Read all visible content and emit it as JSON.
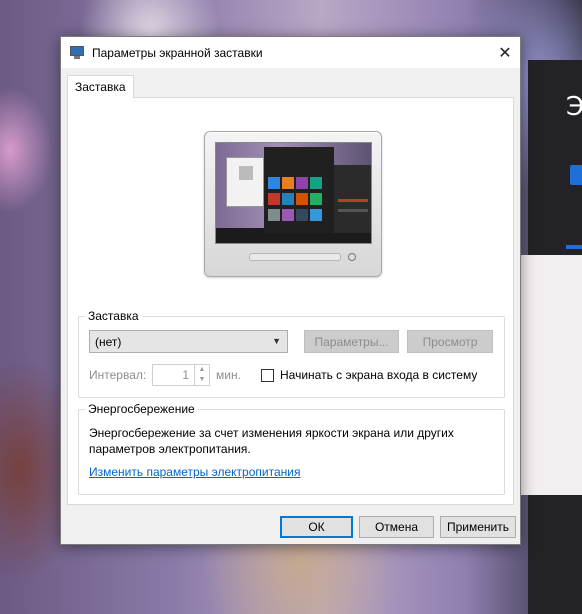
{
  "window": {
    "title": "Параметры экранной заставки",
    "close_glyph": "✕"
  },
  "tabs": [
    {
      "label": "Заставка",
      "active": true
    }
  ],
  "screensaver": {
    "group_label": "Заставка",
    "selected": "(нет)",
    "settings_button": "Параметры...",
    "preview_button": "Просмотр",
    "interval_label": "Интервал:",
    "interval_value": "1",
    "interval_unit": "мин.",
    "logon_checkbox_label": "Начинать с экрана входа в систему",
    "logon_checked": false
  },
  "power": {
    "group_label": "Энергосбережение",
    "description": "Энергосбережение за счет изменения яркости экрана или других параметров электропитания.",
    "link": "Изменить параметры электропитания"
  },
  "footer": {
    "ok": "ОК",
    "cancel": "Отмена",
    "apply": "Применить"
  },
  "colors": {
    "accent": "#0078d7",
    "link": "#0066cc",
    "disabled_text": "#8d8d8d"
  },
  "background": {
    "partial_char": "Э"
  }
}
